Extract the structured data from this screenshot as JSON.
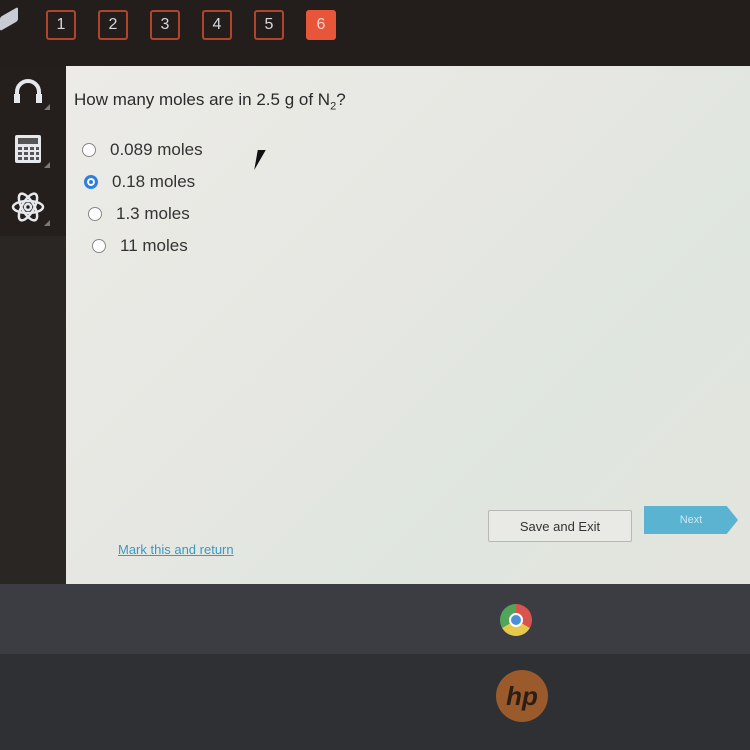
{
  "question_nav": {
    "items": [
      "1",
      "2",
      "3",
      "4",
      "5",
      "6"
    ],
    "active_index": 5
  },
  "sidebar": {
    "tools": [
      {
        "name": "headphones",
        "icon": "headphones-icon"
      },
      {
        "name": "calculator",
        "icon": "calculator-icon"
      },
      {
        "name": "periodic-table",
        "icon": "atom-icon"
      }
    ]
  },
  "question": {
    "text_before": "How many moles are in 2.5 g of N",
    "subscript": "2",
    "text_after": "?"
  },
  "options": [
    {
      "label": "0.089 moles",
      "selected": false
    },
    {
      "label": "0.18 moles",
      "selected": true
    },
    {
      "label": "1.3 moles",
      "selected": false
    },
    {
      "label": "11 moles",
      "selected": false
    }
  ],
  "footer": {
    "mark_link": "Mark this and return",
    "save_exit": "Save and Exit",
    "next": "Next"
  },
  "taskbar": {
    "apps": [
      "chrome-icon"
    ]
  },
  "bezel": {
    "logo": "hp"
  },
  "colors": {
    "active_question": "#e8563a",
    "radio_selected": "#2f7fe0",
    "next_button": "#5ab3d0",
    "link": "#3a9ac0"
  }
}
